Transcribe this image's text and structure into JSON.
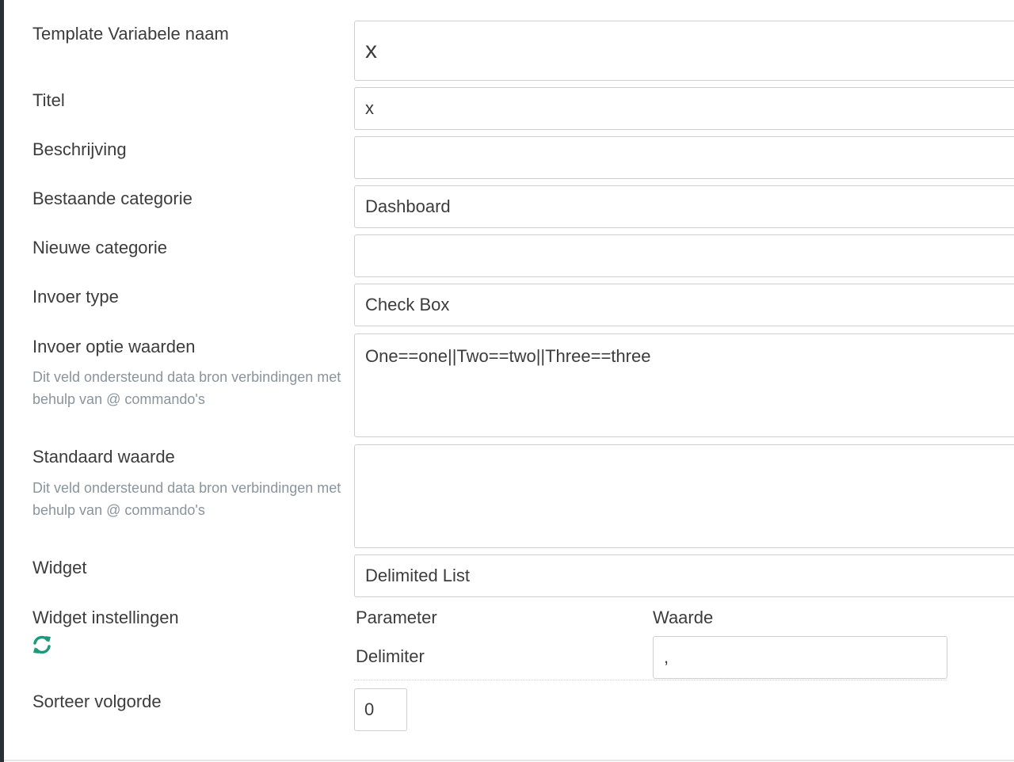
{
  "form": {
    "name": {
      "label": "Template Variabele naam",
      "value": "x"
    },
    "title": {
      "label": "Titel",
      "value": "x"
    },
    "description": {
      "label": "Beschrijving",
      "value": ""
    },
    "existing_category": {
      "label": "Bestaande categorie",
      "value": "Dashboard"
    },
    "new_category": {
      "label": "Nieuwe categorie",
      "value": ""
    },
    "input_type": {
      "label": "Invoer type",
      "value": "Check Box"
    },
    "input_options": {
      "label": "Invoer optie waarden",
      "help": "Dit veld ondersteund data bron verbindingen met behulp van @ commando's",
      "value": "One==one||Two==two||Three==three"
    },
    "default_value": {
      "label": "Standaard waarde",
      "help": "Dit veld ondersteund data bron verbindingen met behulp van @ commando's",
      "value": ""
    },
    "widget": {
      "label": "Widget",
      "value": "Delimited List"
    },
    "widget_settings": {
      "label": "Widget instellingen",
      "refresh_icon": "refresh-icon",
      "refresh_color": "#1a9a7a",
      "parameter_header": "Parameter",
      "value_header": "Waarde",
      "rows": [
        {
          "parameter": "Delimiter",
          "value": ","
        }
      ]
    },
    "sort_order": {
      "label": "Sorteer volgorde",
      "value": "0"
    }
  }
}
